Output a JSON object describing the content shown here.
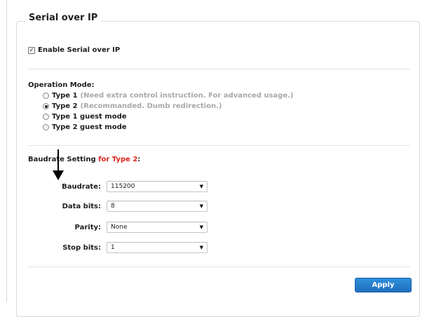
{
  "section": {
    "legend": "Serial over IP"
  },
  "enable": {
    "label": "Enable Serial over IP",
    "checked": true
  },
  "operation_mode": {
    "title": "Operation Mode:",
    "options": [
      {
        "label": "Type 1",
        "desc": "(Need extra control instruction. For advanced usage.)",
        "selected": false
      },
      {
        "label": "Type 2",
        "desc": "(Recommanded. Dumb redirection.)",
        "selected": true
      },
      {
        "label": "Type 1 guest mode",
        "desc": "",
        "selected": false
      },
      {
        "label": "Type 2 guest mode",
        "desc": "",
        "selected": false
      }
    ]
  },
  "baudrate_setting": {
    "title_prefix": "Baudrate Setting ",
    "title_accent": "for Type 2",
    "title_suffix": ":",
    "accent_color": "#e0231d",
    "fields": [
      {
        "label": "Baudrate:",
        "value": "115200"
      },
      {
        "label": "Data bits:",
        "value": "8"
      },
      {
        "label": "Parity:",
        "value": "None"
      },
      {
        "label": "Stop bits:",
        "value": "1"
      }
    ]
  },
  "apply": {
    "label": "Apply",
    "color": "#1f77c9"
  }
}
